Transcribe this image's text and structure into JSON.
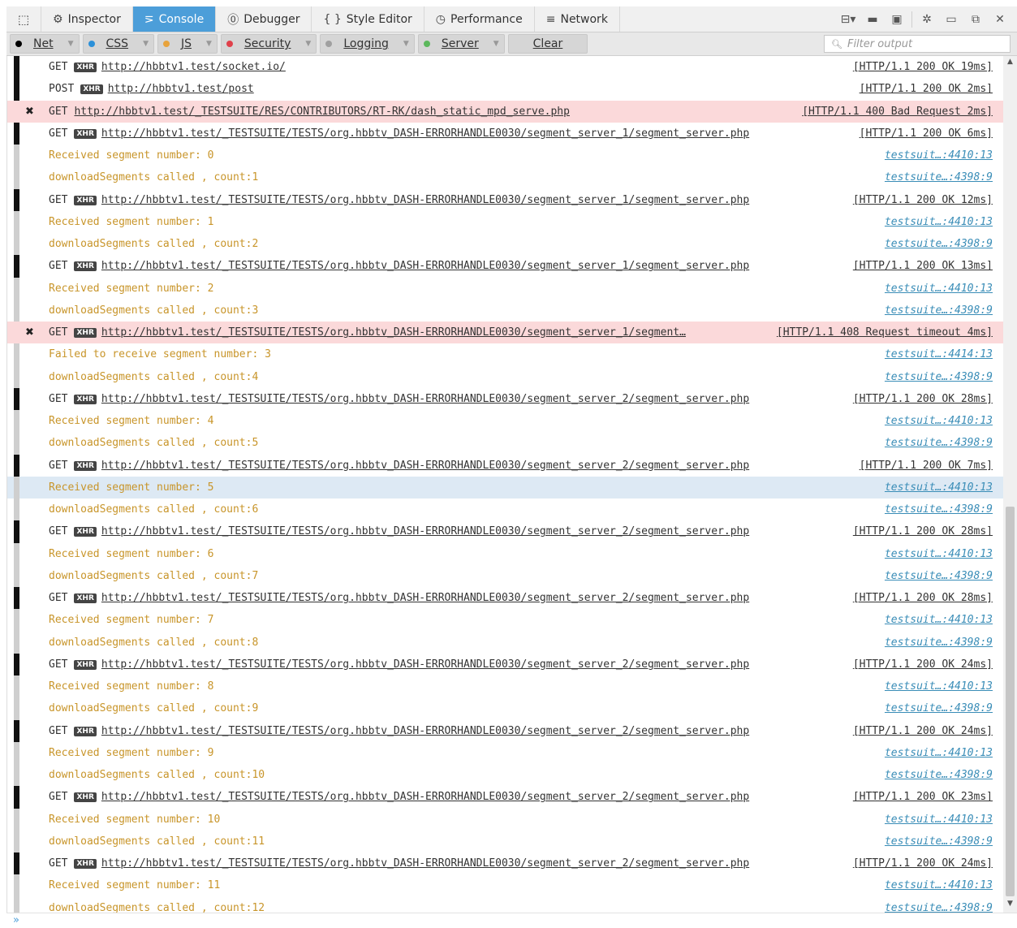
{
  "toolbar": {
    "picker_icon": "element-picker-icon",
    "tabs": [
      {
        "label": "Inspector",
        "icon": "inspector-icon",
        "glyph": "⚙"
      },
      {
        "label": "Console",
        "icon": "console-icon",
        "glyph": "⋝"
      },
      {
        "label": "Debugger",
        "icon": "debugger-icon",
        "glyph": "⓪"
      },
      {
        "label": "Style Editor",
        "icon": "style-editor-icon",
        "glyph": "{ }"
      },
      {
        "label": "Performance",
        "icon": "performance-icon",
        "glyph": "◷"
      },
      {
        "label": "Network",
        "icon": "network-icon",
        "glyph": "≡"
      }
    ],
    "active_tab": "Console"
  },
  "filters": {
    "categories": [
      {
        "label": "Net",
        "color": "#000000"
      },
      {
        "label": "CSS",
        "color": "#2b90d9"
      },
      {
        "label": "JS",
        "color": "#e8a33c"
      },
      {
        "label": "Security",
        "color": "#e0404a"
      },
      {
        "label": "Logging",
        "color": "#a0a0a0"
      },
      {
        "label": "Server",
        "color": "#5cb85c"
      }
    ],
    "clear_label": "Clear",
    "filter_placeholder": "Filter output"
  },
  "rows": [
    {
      "kind": "net",
      "method": "GET",
      "xhr": true,
      "url": "http://hbbtv1.test/socket.io/",
      "status": "[HTTP/1.1 200 OK 19ms]"
    },
    {
      "kind": "net",
      "method": "POST",
      "xhr": true,
      "url": "http://hbbtv1.test/post",
      "status": "[HTTP/1.1 200 OK 2ms]"
    },
    {
      "kind": "net",
      "method": "GET",
      "xhr": false,
      "url": "http://hbbtv1.test/_TESTSUITE/RES/CONTRIBUTORS/RT-RK/dash_static_mpd_serve.php",
      "status": "[HTTP/1.1 400 Bad Request 2ms]",
      "error": true
    },
    {
      "kind": "net",
      "method": "GET",
      "xhr": true,
      "url": "http://hbbtv1.test/_TESTSUITE/TESTS/org.hbbtv_DASH-ERRORHANDLE0030/segment_server_1/segment_server.php",
      "status": "[HTTP/1.1 200 OK 6ms]"
    },
    {
      "kind": "log",
      "text": "Received segment number: 0",
      "loc": "testsuit…:4410:13"
    },
    {
      "kind": "log",
      "text": "downloadSegments called , count:1",
      "loc": "testsuite…:4398:9"
    },
    {
      "kind": "net",
      "method": "GET",
      "xhr": true,
      "url": "http://hbbtv1.test/_TESTSUITE/TESTS/org.hbbtv_DASH-ERRORHANDLE0030/segment_server_1/segment_server.php",
      "status": "[HTTP/1.1 200 OK 12ms]"
    },
    {
      "kind": "log",
      "text": "Received segment number: 1",
      "loc": "testsuit…:4410:13"
    },
    {
      "kind": "log",
      "text": "downloadSegments called , count:2",
      "loc": "testsuite…:4398:9"
    },
    {
      "kind": "net",
      "method": "GET",
      "xhr": true,
      "url": "http://hbbtv1.test/_TESTSUITE/TESTS/org.hbbtv_DASH-ERRORHANDLE0030/segment_server_1/segment_server.php",
      "status": "[HTTP/1.1 200 OK 13ms]"
    },
    {
      "kind": "log",
      "text": "Received segment number: 2",
      "loc": "testsuit…:4410:13"
    },
    {
      "kind": "log",
      "text": "downloadSegments called , count:3",
      "loc": "testsuite…:4398:9"
    },
    {
      "kind": "net",
      "method": "GET",
      "xhr": true,
      "url": "http://hbbtv1.test/_TESTSUITE/TESTS/org.hbbtv_DASH-ERRORHANDLE0030/segment_server_1/segment…",
      "status": "[HTTP/1.1 408 Request timeout 4ms]",
      "error": true
    },
    {
      "kind": "log",
      "text": "Failed to receive segment number: 3",
      "loc": "testsuit…:4414:13"
    },
    {
      "kind": "log",
      "text": "downloadSegments called , count:4",
      "loc": "testsuite…:4398:9"
    },
    {
      "kind": "net",
      "method": "GET",
      "xhr": true,
      "url": "http://hbbtv1.test/_TESTSUITE/TESTS/org.hbbtv_DASH-ERRORHANDLE0030/segment_server_2/segment_server.php",
      "status": "[HTTP/1.1 200 OK 28ms]"
    },
    {
      "kind": "log",
      "text": "Received segment number: 4",
      "loc": "testsuit…:4410:13"
    },
    {
      "kind": "log",
      "text": "downloadSegments called , count:5",
      "loc": "testsuite…:4398:9"
    },
    {
      "kind": "net",
      "method": "GET",
      "xhr": true,
      "url": "http://hbbtv1.test/_TESTSUITE/TESTS/org.hbbtv_DASH-ERRORHANDLE0030/segment_server_2/segment_server.php",
      "status": "[HTTP/1.1 200 OK 7ms]"
    },
    {
      "kind": "log",
      "text": "Received segment number: 5",
      "loc": "testsuit…:4410:13",
      "selected": true
    },
    {
      "kind": "log",
      "text": "downloadSegments called , count:6",
      "loc": "testsuite…:4398:9"
    },
    {
      "kind": "net",
      "method": "GET",
      "xhr": true,
      "url": "http://hbbtv1.test/_TESTSUITE/TESTS/org.hbbtv_DASH-ERRORHANDLE0030/segment_server_2/segment_server.php",
      "status": "[HTTP/1.1 200 OK 28ms]"
    },
    {
      "kind": "log",
      "text": "Received segment number: 6",
      "loc": "testsuit…:4410:13"
    },
    {
      "kind": "log",
      "text": "downloadSegments called , count:7",
      "loc": "testsuite…:4398:9"
    },
    {
      "kind": "net",
      "method": "GET",
      "xhr": true,
      "url": "http://hbbtv1.test/_TESTSUITE/TESTS/org.hbbtv_DASH-ERRORHANDLE0030/segment_server_2/segment_server.php",
      "status": "[HTTP/1.1 200 OK 28ms]"
    },
    {
      "kind": "log",
      "text": "Received segment number: 7",
      "loc": "testsuit…:4410:13"
    },
    {
      "kind": "log",
      "text": "downloadSegments called , count:8",
      "loc": "testsuite…:4398:9"
    },
    {
      "kind": "net",
      "method": "GET",
      "xhr": true,
      "url": "http://hbbtv1.test/_TESTSUITE/TESTS/org.hbbtv_DASH-ERRORHANDLE0030/segment_server_2/segment_server.php",
      "status": "[HTTP/1.1 200 OK 24ms]"
    },
    {
      "kind": "log",
      "text": "Received segment number: 8",
      "loc": "testsuit…:4410:13"
    },
    {
      "kind": "log",
      "text": "downloadSegments called , count:9",
      "loc": "testsuite…:4398:9"
    },
    {
      "kind": "net",
      "method": "GET",
      "xhr": true,
      "url": "http://hbbtv1.test/_TESTSUITE/TESTS/org.hbbtv_DASH-ERRORHANDLE0030/segment_server_2/segment_server.php",
      "status": "[HTTP/1.1 200 OK 24ms]"
    },
    {
      "kind": "log",
      "text": "Received segment number: 9",
      "loc": "testsuit…:4410:13"
    },
    {
      "kind": "log",
      "text": "downloadSegments called , count:10",
      "loc": "testsuite…:4398:9"
    },
    {
      "kind": "net",
      "method": "GET",
      "xhr": true,
      "url": "http://hbbtv1.test/_TESTSUITE/TESTS/org.hbbtv_DASH-ERRORHANDLE0030/segment_server_2/segment_server.php",
      "status": "[HTTP/1.1 200 OK 23ms]"
    },
    {
      "kind": "log",
      "text": "Received segment number: 10",
      "loc": "testsuit…:4410:13"
    },
    {
      "kind": "log",
      "text": "downloadSegments called , count:11",
      "loc": "testsuite…:4398:9"
    },
    {
      "kind": "net",
      "method": "GET",
      "xhr": true,
      "url": "http://hbbtv1.test/_TESTSUITE/TESTS/org.hbbtv_DASH-ERRORHANDLE0030/segment_server_2/segment_server.php",
      "status": "[HTTP/1.1 200 OK 24ms]"
    },
    {
      "kind": "log",
      "text": "Received segment number: 11",
      "loc": "testsuit…:4410:13"
    },
    {
      "kind": "log",
      "text": "downloadSegments called , count:12",
      "loc": "testsuite…:4398:9"
    }
  ],
  "input": {
    "prompt": "»"
  }
}
